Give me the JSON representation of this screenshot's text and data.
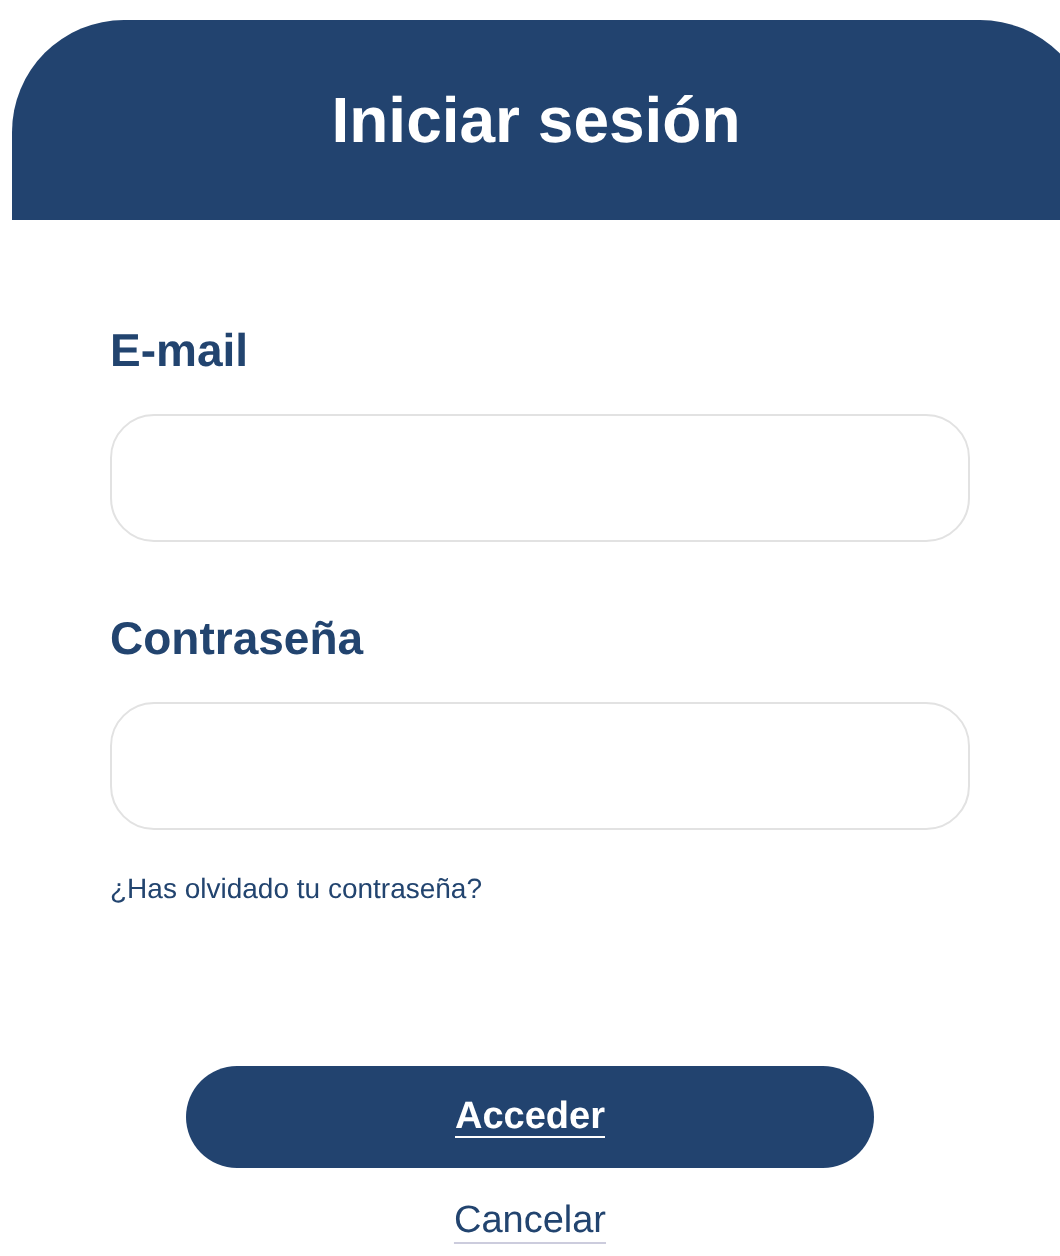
{
  "header": {
    "title": "Iniciar sesión"
  },
  "fields": [
    {
      "label": "E-mail"
    },
    {
      "label": "Contraseña"
    }
  ],
  "forgot_link": "¿Has olvidado tu contraseña?",
  "submit_button": "Acceder",
  "cancel_link": "Cancelar"
}
